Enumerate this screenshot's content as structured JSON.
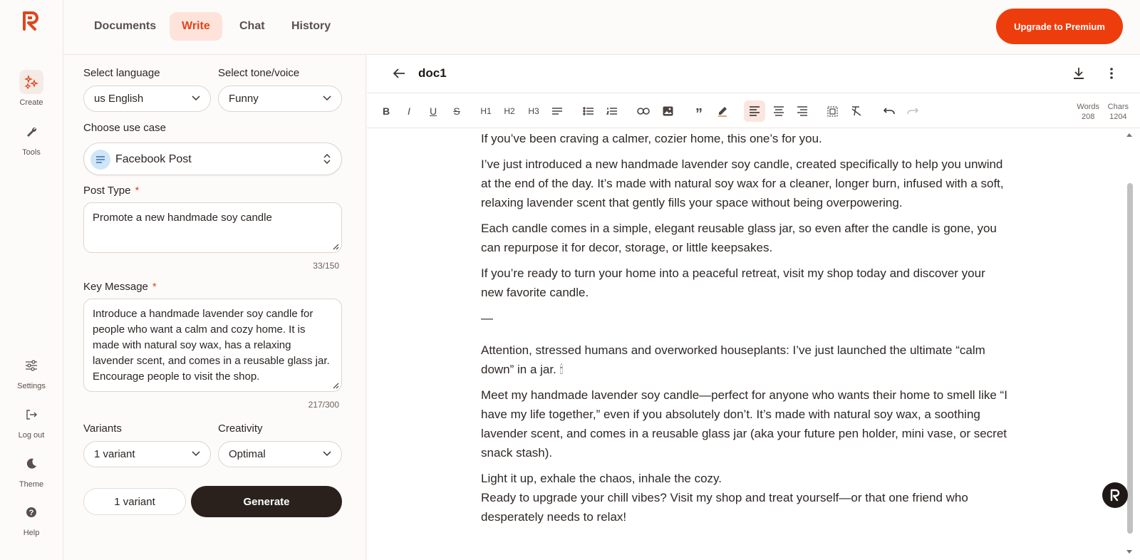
{
  "nav": {
    "tabs": [
      "Documents",
      "Write",
      "Chat",
      "History"
    ],
    "active_tab": "Write",
    "upgrade_label": "Upgrade to Premium"
  },
  "rail": {
    "create": "Create",
    "tools": "Tools",
    "settings": "Settings",
    "logout": "Log out",
    "theme": "Theme",
    "help": "Help"
  },
  "form": {
    "language_label": "Select language",
    "language_value": "us English",
    "tone_label": "Select tone/voice",
    "tone_value": "Funny",
    "usecase_label": "Choose use case",
    "usecase_value": "Facebook Post",
    "post_type_label": "Post Type",
    "post_type_value": "Promote a new handmade soy candle",
    "post_type_count": "33/150",
    "key_message_label": "Key Message",
    "key_message_value": "Introduce a handmade lavender soy candle for people who want a calm and cozy home. It is made with natural soy wax, has a relaxing lavender scent, and comes in a reusable glass jar. Encourage people to visit the shop.",
    "key_message_count": "217/300",
    "variants_label": "Variants",
    "variants_value": "1 variant",
    "creativity_label": "Creativity",
    "creativity_value": "Optimal",
    "variant_button": "1 variant",
    "generate_button": "Generate",
    "required_mark": "*"
  },
  "editor": {
    "doc_title": "doc1",
    "toolbar": {
      "h1": "H1",
      "h2": "H2",
      "h3": "H3"
    },
    "stats": {
      "words_label": "Words",
      "words_value": "208",
      "chars_label": "Chars",
      "chars_value": "1204"
    },
    "paragraphs": [
      "If you’ve been craving a calmer, cozier home, this one’s for you.",
      "I’ve just introduced a new handmade lavender soy candle, created specifically to help you unwind at the end of the day. It’s made with natural soy wax for a cleaner, longer burn, infused with a soft, relaxing lavender scent that gently fills your space without being overpowering.",
      "Each candle comes in a simple, elegant reusable glass jar, so even after the candle is gone, you can repurpose it for decor, storage, or little keepsakes.",
      "If you’re ready to turn your home into a peaceful retreat, visit my shop today and discover your new favorite candle.",
      "—",
      "Attention, stressed humans and overworked houseplants: I’ve just launched the ultimate “calm down” in a jar. 🕯",
      "Meet my handmade lavender soy candle—perfect for anyone who wants their home to smell like “I have my life together,” even if you absolutely don’t. It’s made with natural soy wax, a soothing lavender scent, and comes in a reusable glass jar (aka your future pen holder, mini vase, or secret snack stash).",
      "Light it up, exhale the chaos, inhale the cozy.",
      "Ready to upgrade your chill vibes? Visit my shop and treat yourself—or that one friend who desperately needs to relax!"
    ]
  },
  "colors": {
    "accent": "#ee3d0c",
    "active_tab_bg": "#fde3da",
    "dark_button": "#2a211d"
  }
}
